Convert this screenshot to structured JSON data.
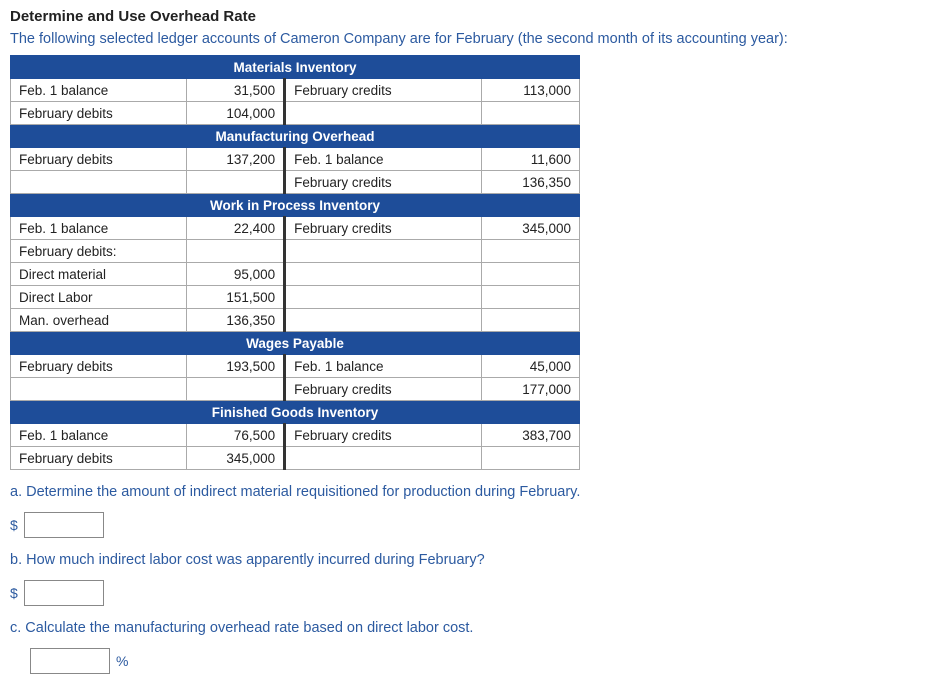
{
  "title": "Determine and Use Overhead Rate",
  "intro": "The following selected ledger accounts of Cameron Company are for February (the second month of its accounting year):",
  "sections": {
    "materials": {
      "header": "Materials Inventory",
      "rows": [
        {
          "l1": "Feb. 1 balance",
          "l2": "31,500",
          "r1": "February credits",
          "r2": "113,000"
        },
        {
          "l1": "February debits",
          "l2": "104,000",
          "r1": "",
          "r2": ""
        }
      ]
    },
    "manufacturing": {
      "header": "Manufacturing Overhead",
      "rows": [
        {
          "l1": "February debits",
          "l2": "137,200",
          "r1": "Feb. 1 balance",
          "r2": "11,600"
        },
        {
          "l1": "",
          "l2": "",
          "r1": "February credits",
          "r2": "136,350"
        }
      ]
    },
    "wip": {
      "header": "Work in Process Inventory",
      "rows": [
        {
          "l1": "Feb. 1 balance",
          "l2": "22,400",
          "r1": "February credits",
          "r2": "345,000"
        },
        {
          "l1": "February debits:",
          "l2": "",
          "r1": "",
          "r2": ""
        },
        {
          "l1": "Direct material",
          "l2": "95,000",
          "r1": "",
          "r2": ""
        },
        {
          "l1": "Direct Labor",
          "l2": "151,500",
          "r1": "",
          "r2": ""
        },
        {
          "l1": "Man. overhead",
          "l2": "136,350",
          "r1": "",
          "r2": ""
        }
      ]
    },
    "wages": {
      "header": "Wages Payable",
      "rows": [
        {
          "l1": "February debits",
          "l2": "193,500",
          "r1": "Feb. 1 balance",
          "r2": "45,000"
        },
        {
          "l1": "",
          "l2": "",
          "r1": "February credits",
          "r2": "177,000"
        }
      ]
    },
    "finished": {
      "header": "Finished Goods Inventory",
      "rows": [
        {
          "l1": "Feb. 1 balance",
          "l2": "76,500",
          "r1": "February credits",
          "r2": "383,700"
        },
        {
          "l1": "February debits",
          "l2": "345,000",
          "r1": "",
          "r2": ""
        }
      ]
    }
  },
  "questions": {
    "a": "a. Determine the amount of indirect material requisitioned for production during February.",
    "b": "b. How much indirect labor cost was apparently incurred during February?",
    "c": "c. Calculate the manufacturing overhead rate based on direct labor cost."
  },
  "symbols": {
    "dollar": "$",
    "percent": "%"
  }
}
